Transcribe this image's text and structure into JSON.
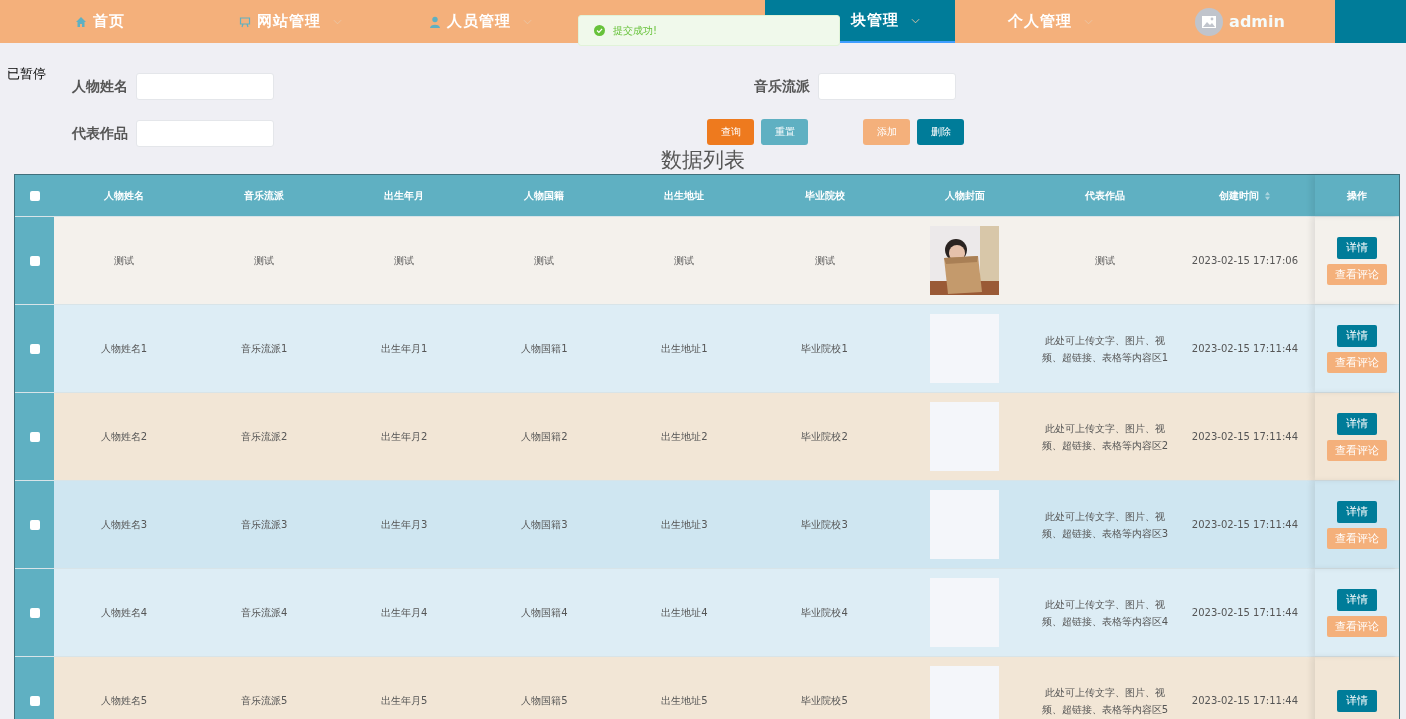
{
  "nav": {
    "items": [
      {
        "label": "首页",
        "has_dropdown": false,
        "selected": false
      },
      {
        "label": "网站管理",
        "has_dropdown": true,
        "selected": false
      },
      {
        "label": "人员管理",
        "has_dropdown": true,
        "selected": false
      },
      {
        "label": "块管理",
        "has_dropdown": true,
        "selected": true
      },
      {
        "label": "个人管理",
        "has_dropdown": true,
        "selected": false
      }
    ],
    "user": {
      "name": "admin"
    }
  },
  "toast": {
    "message": "提交成功!"
  },
  "status_label": "已暂停",
  "search": {
    "fields": [
      {
        "label": "人物姓名"
      },
      {
        "label": "音乐流派"
      },
      {
        "label": "代表作品"
      }
    ],
    "buttons": [
      {
        "label": "查询",
        "kind": "search"
      },
      {
        "label": "重置",
        "kind": "reset"
      },
      {
        "label": "添加",
        "kind": "add"
      },
      {
        "label": "删除",
        "kind": "delete"
      }
    ]
  },
  "table": {
    "title": "数据列表",
    "header_checked": false,
    "columns": [
      {
        "label": "人物姓名",
        "sortable": false
      },
      {
        "label": "音乐流派",
        "sortable": false
      },
      {
        "label": "出生年月",
        "sortable": false
      },
      {
        "label": "人物国籍",
        "sortable": false
      },
      {
        "label": "出生地址",
        "sortable": false
      },
      {
        "label": "毕业院校",
        "sortable": false
      },
      {
        "label": "人物封面",
        "sortable": false
      },
      {
        "label": "代表作品",
        "sortable": false
      },
      {
        "label": "创建时间",
        "sortable": true
      },
      {
        "label": "操作",
        "sortable": false
      }
    ],
    "rows": [
      {
        "checked": false,
        "cells": [
          "测试",
          "测试",
          "测试",
          "测试",
          "测试",
          "测试"
        ],
        "cover": {
          "kind": "picture"
        },
        "works": "测试",
        "created": "2023-02-15 17:17:06",
        "actions": [
          "详情",
          "查看评论"
        ]
      },
      {
        "checked": false,
        "cells": [
          "人物姓名1",
          "音乐流派1",
          "出生年月1",
          "人物国籍1",
          "出生地址1",
          "毕业院校1"
        ],
        "cover": {
          "kind": "blank"
        },
        "works": "此处可上传文字、图片、视频、超链接、表格等内容区1",
        "created": "2023-02-15 17:11:44",
        "actions": [
          "详情",
          "查看评论"
        ]
      },
      {
        "checked": false,
        "cells": [
          "人物姓名2",
          "音乐流派2",
          "出生年月2",
          "人物国籍2",
          "出生地址2",
          "毕业院校2"
        ],
        "cover": {
          "kind": "blank"
        },
        "works": "此处可上传文字、图片、视频、超链接、表格等内容区2",
        "created": "2023-02-15 17:11:44",
        "actions": [
          "详情",
          "查看评论"
        ]
      },
      {
        "checked": false,
        "cells": [
          "人物姓名3",
          "音乐流派3",
          "出生年月3",
          "人物国籍3",
          "出生地址3",
          "毕业院校3"
        ],
        "cover": {
          "kind": "blank"
        },
        "works": "此处可上传文字、图片、视频、超链接、表格等内容区3",
        "created": "2023-02-15 17:11:44",
        "actions": [
          "详情",
          "查看评论"
        ]
      },
      {
        "checked": false,
        "cells": [
          "人物姓名4",
          "音乐流派4",
          "出生年月4",
          "人物国籍4",
          "出生地址4",
          "毕业院校4"
        ],
        "cover": {
          "kind": "blank"
        },
        "works": "此处可上传文字、图片、视频、超链接、表格等内容区4",
        "created": "2023-02-15 17:11:44",
        "actions": [
          "详情",
          "查看评论"
        ]
      },
      {
        "checked": false,
        "cells": [
          "人物姓名5",
          "音乐流派5",
          "出生年月5",
          "人物国籍5",
          "出生地址5",
          "毕业院校5"
        ],
        "cover": {
          "kind": "blank"
        },
        "works": "此处可上传文字、图片、视频、超链接、表格等内容区5",
        "created": "2023-02-15 17:11:44",
        "actions": [
          "详情"
        ]
      }
    ]
  }
}
